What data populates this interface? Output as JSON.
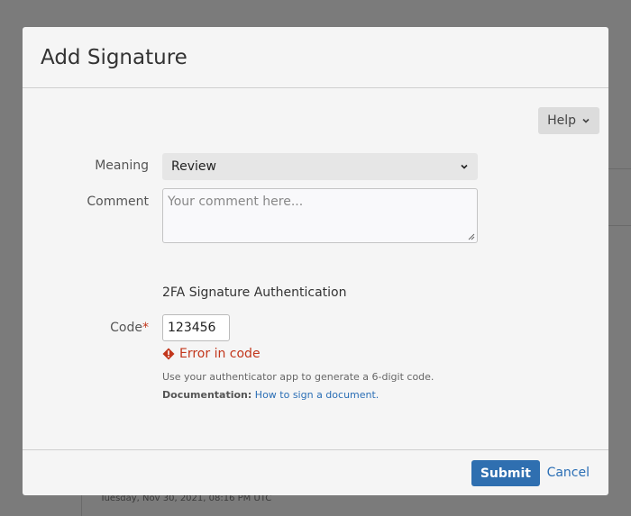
{
  "background": {
    "timestamp": "Tuesday, Nov 30, 2021, 08:16 PM UTC"
  },
  "dialog": {
    "title": "Add Signature",
    "help_label": "Help",
    "meaning": {
      "label": "Meaning",
      "selected": "Review"
    },
    "comment": {
      "label": "Comment",
      "placeholder": "Your comment here..."
    },
    "section_title": "2FA Signature Authentication",
    "code": {
      "label": "Code",
      "required_marker": "*",
      "value": "123456",
      "error": "Error in code"
    },
    "help_text": "Use your authenticator app to generate a 6-digit code.",
    "documentation": {
      "label": "Documentation:",
      "link_text": "How to sign a document."
    },
    "submit_label": "Submit",
    "cancel_label": "Cancel"
  },
  "colors": {
    "primary": "#2f6fb0",
    "error": "#c2361b",
    "link": "#2a6eb5"
  }
}
